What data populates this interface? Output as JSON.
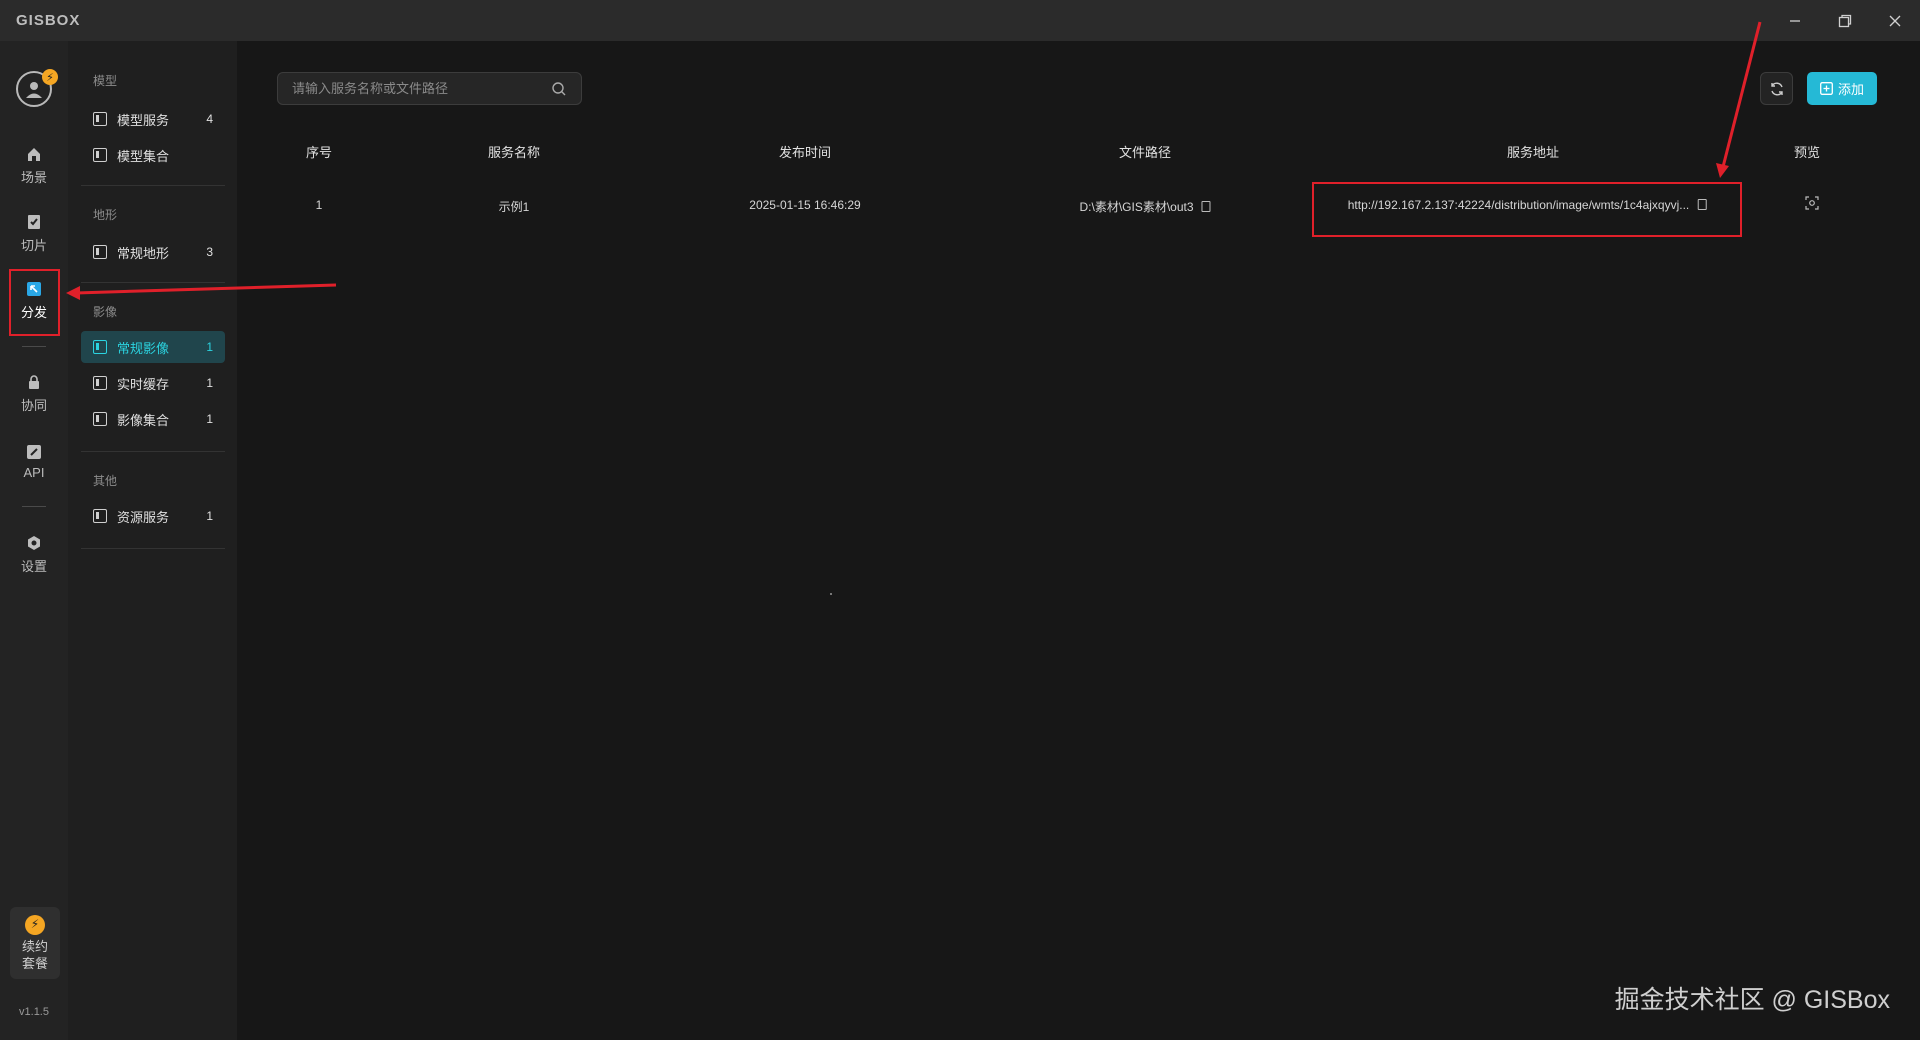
{
  "app": {
    "logo": "GISBOX"
  },
  "window_controls": [
    "minimize-icon",
    "restore-icon",
    "close-icon"
  ],
  "rail": {
    "avatar_badge": "⚡",
    "items": [
      {
        "label": "场景",
        "icon": "home-icon"
      },
      {
        "label": "切片",
        "icon": "slice-icon"
      },
      {
        "label": "分发",
        "icon": "distribute-icon",
        "active": true
      },
      {
        "label": "协同",
        "icon": "collab-icon"
      },
      {
        "label": "API",
        "icon": "api-icon"
      },
      {
        "label": "设置",
        "icon": "settings-icon"
      }
    ],
    "renew_label": "续约套餐",
    "renew_icon": "⚡",
    "version": "v1.1.5"
  },
  "sidebar": {
    "groups": [
      {
        "title": "模型",
        "items": [
          {
            "label": "模型服务",
            "count": "4"
          },
          {
            "label": "模型集合",
            "count": ""
          }
        ]
      },
      {
        "title": "地形",
        "items": [
          {
            "label": "常规地形",
            "count": "3"
          }
        ]
      },
      {
        "title": "影像",
        "items": [
          {
            "label": "常规影像",
            "count": "1",
            "active": true
          },
          {
            "label": "实时缓存",
            "count": "1"
          },
          {
            "label": "影像集合",
            "count": "1"
          }
        ]
      },
      {
        "title": "其他",
        "items": [
          {
            "label": "资源服务",
            "count": "1"
          }
        ]
      }
    ]
  },
  "toolbar": {
    "search_placeholder": "请输入服务名称或文件路径",
    "add_label": "添加",
    "accent_color": "#25b9d6"
  },
  "table": {
    "headers": [
      "序号",
      "服务名称",
      "发布时间",
      "文件路径",
      "服务地址",
      "预览"
    ],
    "rows": [
      {
        "index": "1",
        "name": "示例1",
        "time": "2025-01-15 16:46:29",
        "path": "D:\\素材\\GIS素材\\out3",
        "url": "http://192.167.2.137:42224/distribution/image/wmts/1c4ajxqyvj..."
      }
    ]
  },
  "watermark": "掘金技术社区 @ GISBox"
}
